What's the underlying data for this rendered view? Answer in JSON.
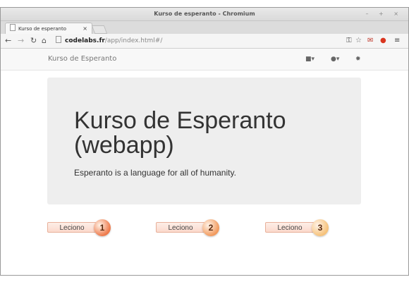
{
  "browser": {
    "window_title": "Kurso de esperanto - Chromium",
    "tab_title": "Kurso de esperanto",
    "tab_close": "×",
    "window_controls": "– + ×",
    "address": {
      "host": "codelabs.fr",
      "path": "/app/index.html#/"
    },
    "icons": [
      "back-icon",
      "forward-icon",
      "reload-icon",
      "home-icon",
      "page-icon",
      "key-icon",
      "star-icon",
      "gmail-icon",
      "opera-icon",
      "menu-icon"
    ]
  },
  "navbar": {
    "brand": "Kurso de Esperanto",
    "icons": [
      "book-dropdown-icon",
      "help-dropdown-icon",
      "gear-icon"
    ]
  },
  "hero": {
    "title": "Kurso de Esperanto (webapp)",
    "lead": "Esperanto is a language for all of humanity."
  },
  "lessons": [
    {
      "label": "Leciono",
      "number": "1",
      "color": "#ee7a4b"
    },
    {
      "label": "Leciono",
      "number": "2",
      "color": "#f29a5d"
    },
    {
      "label": "Leciono",
      "number": "3",
      "color": "#f6c27a"
    }
  ],
  "colors": {
    "hero_bg": "#eeeeee",
    "navbar_bg": "#f8f8f8",
    "text": "#333333"
  }
}
